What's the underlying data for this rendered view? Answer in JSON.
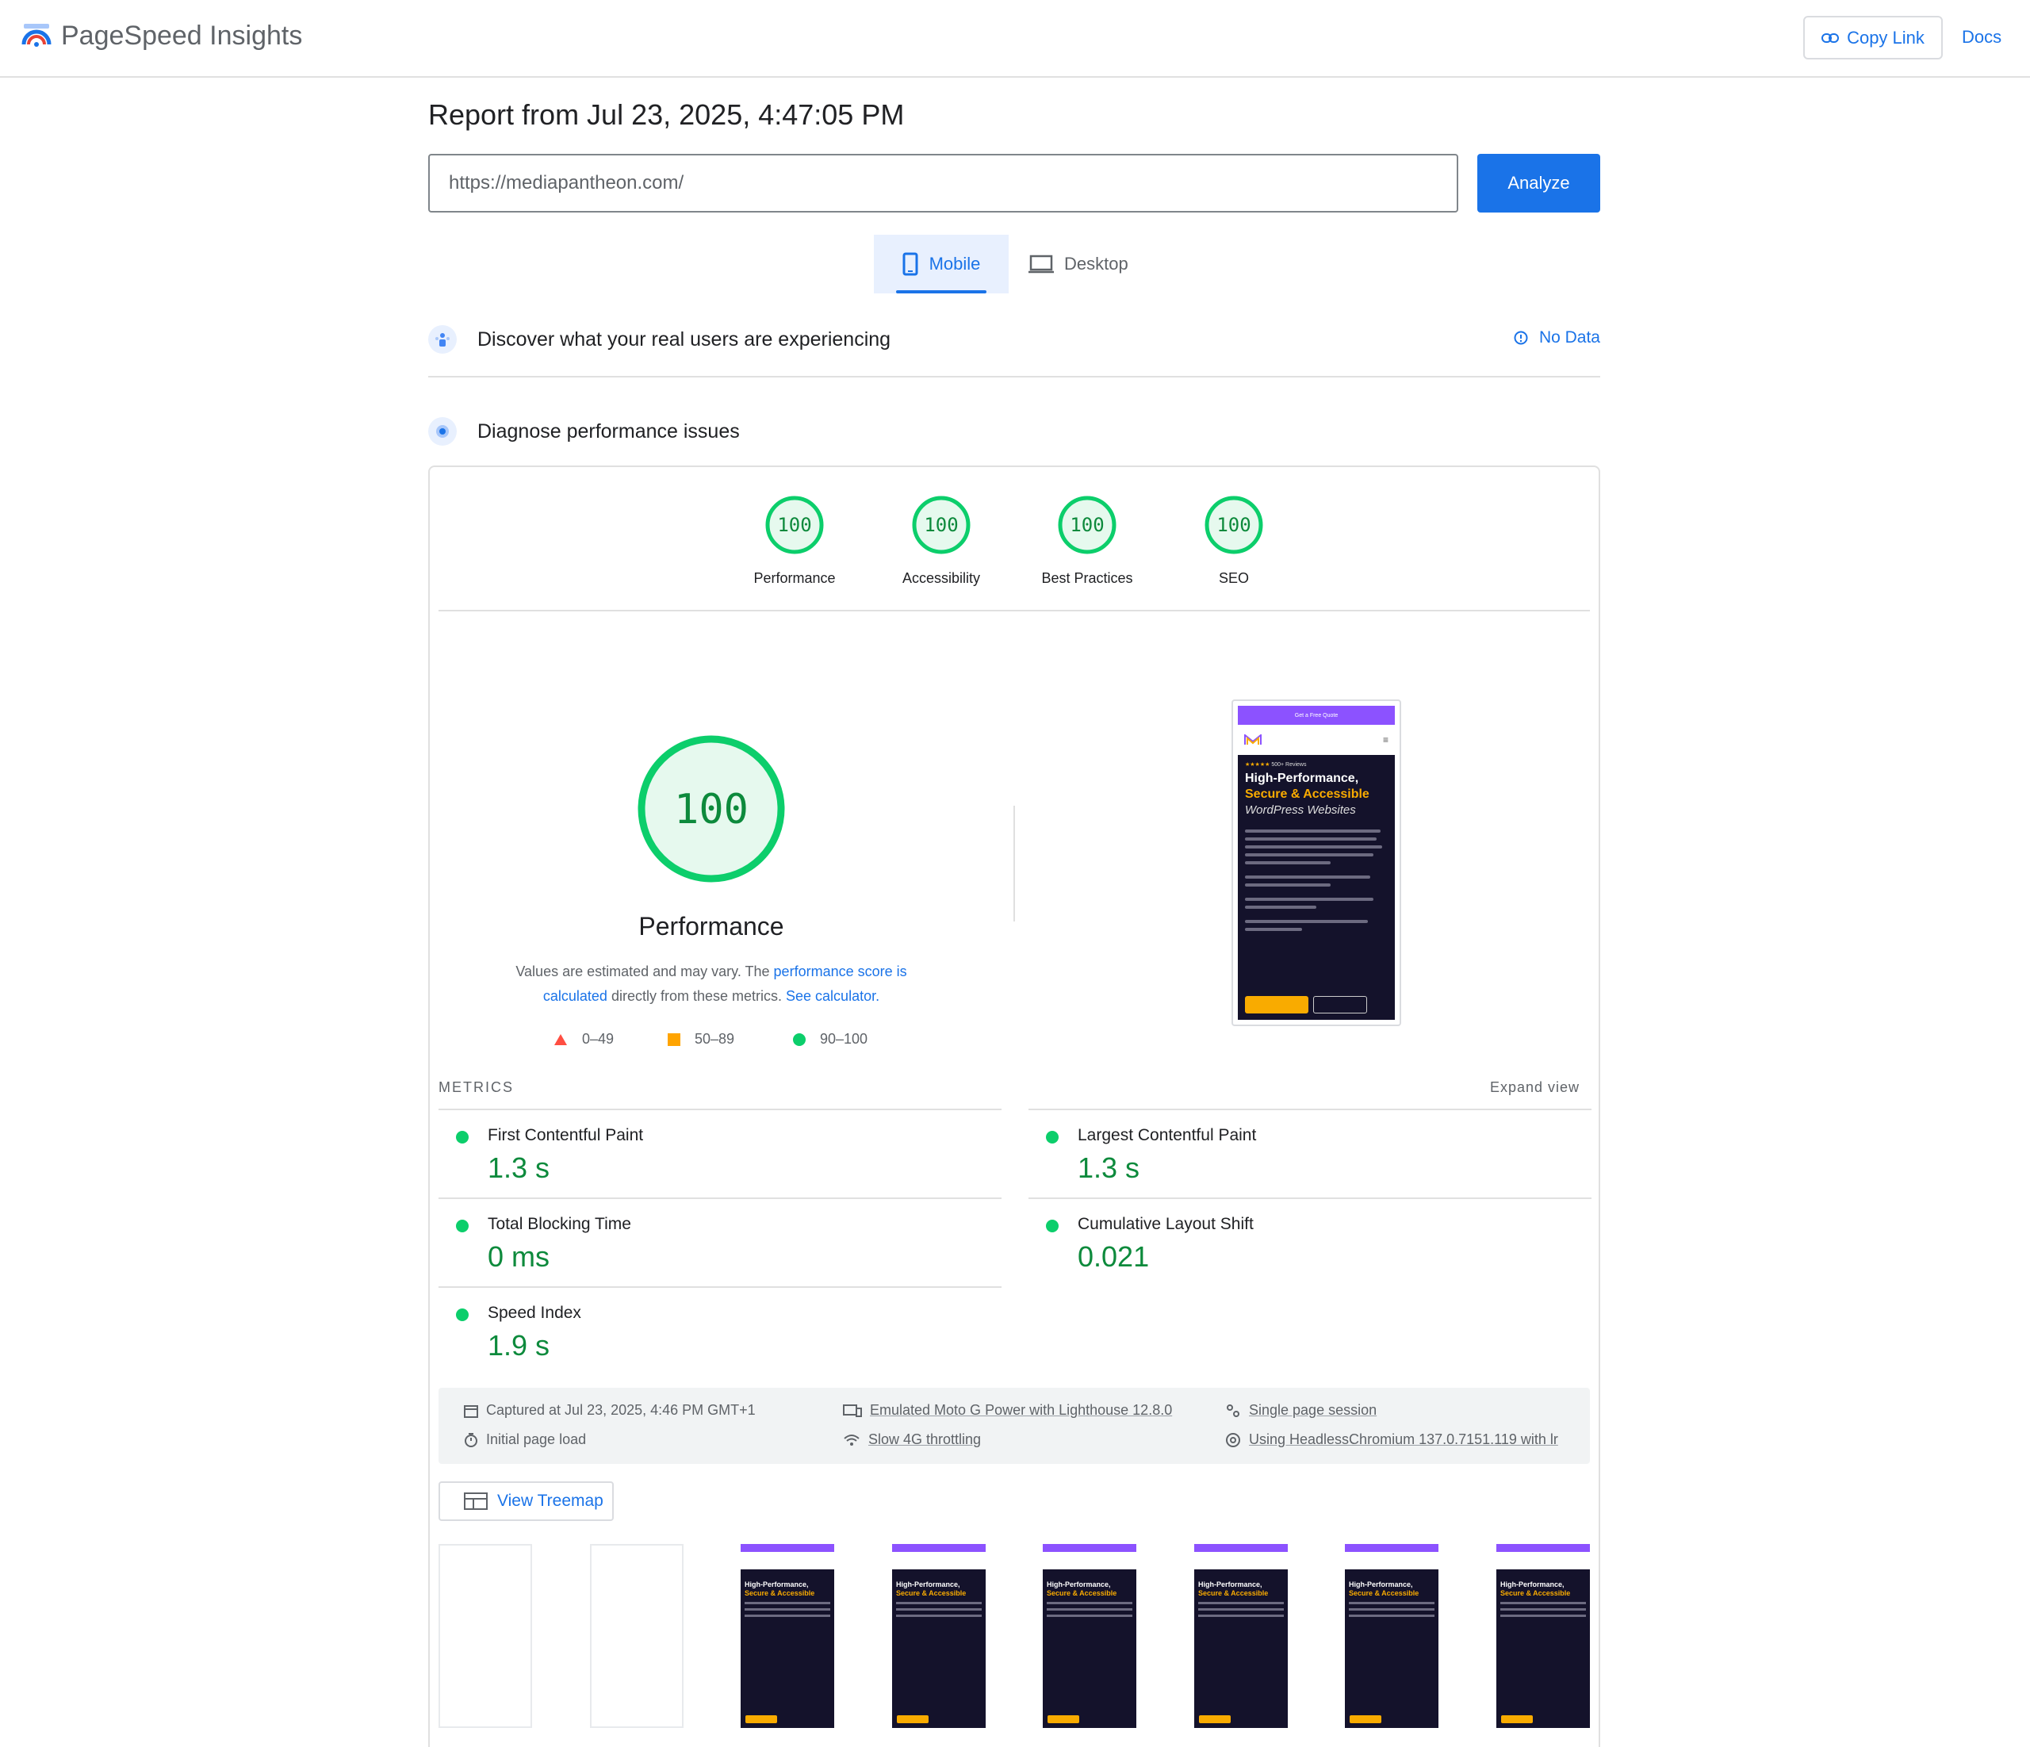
{
  "app": {
    "title": "PageSpeed Insights"
  },
  "header": {
    "copy_link": "Copy Link",
    "docs": "Docs"
  },
  "report": {
    "title": "Report from Jul 23, 2025, 4:47:05 PM",
    "url_value": "https://mediapantheon.com/",
    "analyze_label": "Analyze"
  },
  "tabs": {
    "mobile": "Mobile",
    "desktop": "Desktop",
    "selected": "Mobile"
  },
  "real_users": {
    "title": "Discover what your real users are experiencing",
    "status": "No Data"
  },
  "diagnose": {
    "title": "Diagnose performance issues"
  },
  "scores": [
    {
      "label": "Performance",
      "value": "100"
    },
    {
      "label": "Accessibility",
      "value": "100"
    },
    {
      "label": "Best Practices",
      "value": "100"
    },
    {
      "label": "SEO",
      "value": "100"
    }
  ],
  "performance": {
    "score": "100",
    "label": "Performance",
    "note_prefix": "Values are estimated and may vary. The ",
    "note_link1": "performance score is calculated",
    "note_mid": " directly from these metrics. ",
    "note_link2": "See calculator.",
    "legend": {
      "fail": "0–49",
      "average": "50–89",
      "pass": "90–100"
    }
  },
  "screenshot": {
    "top_strip": "Get a Free Quote",
    "rating": "500+ Reviews",
    "headline_1": "High-Performance,",
    "headline_2": "Secure & Accessible",
    "headline_3": "WordPress Websites"
  },
  "metrics": {
    "heading": "METRICS",
    "expand": "Expand view",
    "items": [
      {
        "name": "First Contentful Paint",
        "value": "1.3 s"
      },
      {
        "name": "Largest Contentful Paint",
        "value": "1.3 s"
      },
      {
        "name": "Total Blocking Time",
        "value": "0 ms"
      },
      {
        "name": "Cumulative Layout Shift",
        "value": "0.021"
      },
      {
        "name": "Speed Index",
        "value": "1.9 s"
      }
    ]
  },
  "environment": {
    "captured": "Captured at Jul 23, 2025, 4:46 PM GMT+1",
    "load": "Initial page load",
    "device": "Emulated Moto G Power with Lighthouse 12.8.0",
    "throttling": "Slow 4G throttling",
    "session": "Single page session",
    "browser": "Using HeadlessChromium 137.0.7151.119 with lr"
  },
  "treemap": {
    "label": "View Treemap"
  },
  "colors": {
    "pass": "#0cce6b",
    "accent": "#1a73e8",
    "average": "#ffa400",
    "fail": "#ff4e42"
  }
}
